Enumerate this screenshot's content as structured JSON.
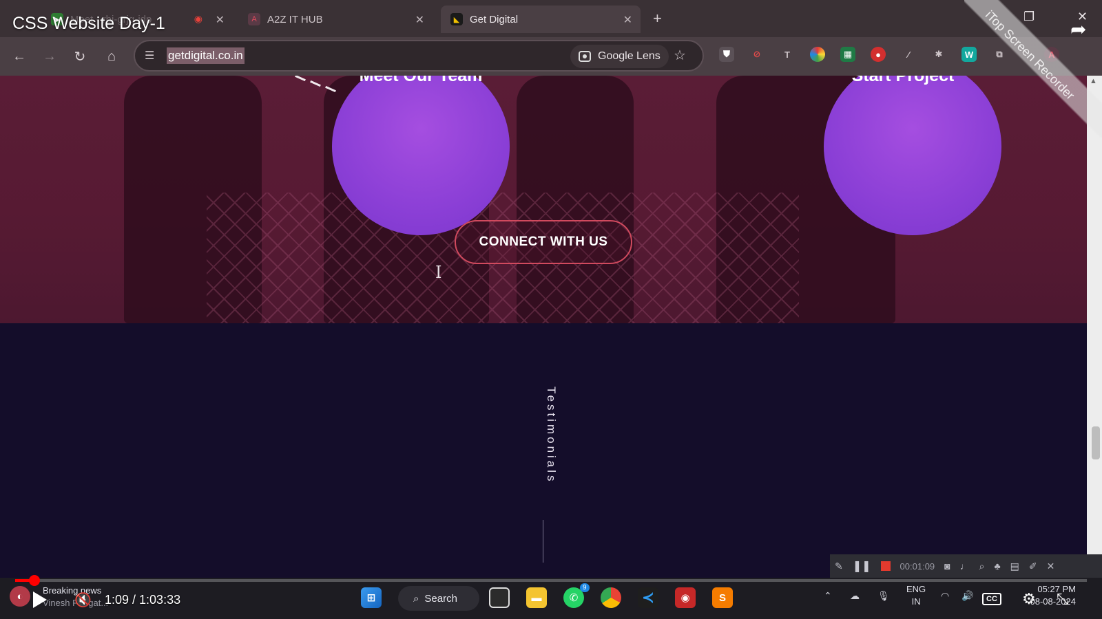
{
  "video": {
    "title": "CSS Website Day-1",
    "current_time": "1:09",
    "duration": "1:03:33",
    "time_display": "1:09 / 1:03:33",
    "progress_fraction": 0.018,
    "cc_label": "CC"
  },
  "browser": {
    "tabs": [
      {
        "label": "Meet - rbi-grjq-idp",
        "active": false
      },
      {
        "label": "A2Z IT HUB",
        "active": false
      },
      {
        "label": "Get Digital",
        "active": true
      }
    ],
    "url": "getdigital.co.in",
    "lens_label": "Google Lens"
  },
  "page": {
    "circles": [
      {
        "label": "Meet Our Team"
      },
      {
        "label": "Start Project"
      }
    ],
    "connect_button": "CONNECT WITH US",
    "testimonials_label": "Testimonials",
    "colors": {
      "hero_bg": "#5a1d36",
      "circle": "#8b3fd6",
      "button_border": "#d14a5e",
      "dark_section": "#140d2a"
    }
  },
  "recorder": {
    "timer": "00:01:09",
    "watermark": "iTop Screen Recorder"
  },
  "taskbar": {
    "search_label": "Search",
    "news_title": "Breaking news",
    "news_sub": "Vinesh Phogat...",
    "language": "ENG",
    "region": "IN",
    "time": "05:27 PM",
    "date": "08-08-2024",
    "whatsapp_badge": "9"
  },
  "icons": [
    "back-icon",
    "forward-icon",
    "reload-icon",
    "home-icon",
    "tune-icon",
    "star-icon",
    "play-icon",
    "mute-icon",
    "settings-icon",
    "fullscreen-icon",
    "share-icon"
  ]
}
